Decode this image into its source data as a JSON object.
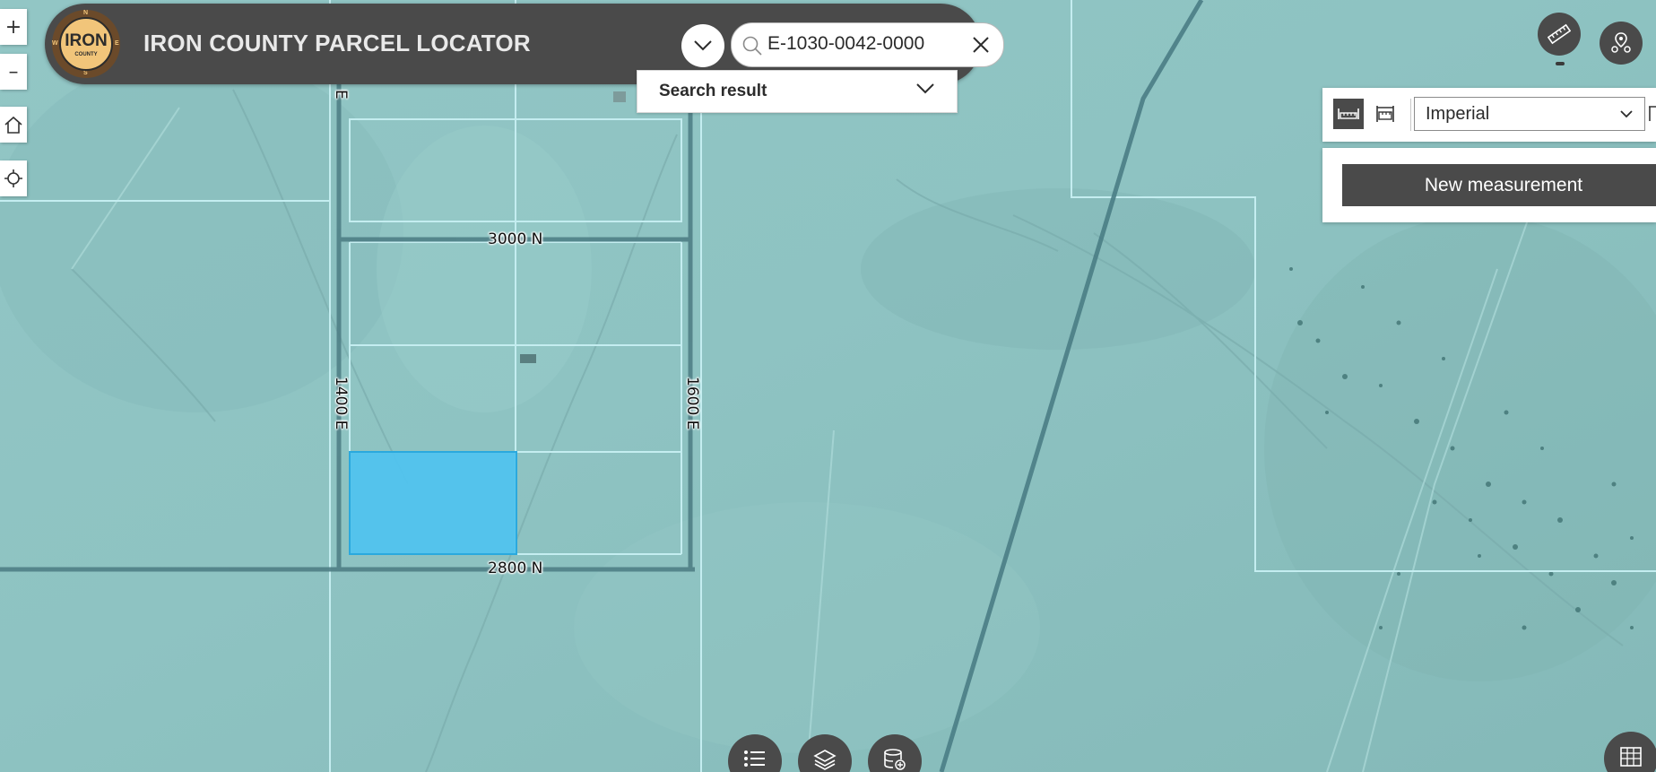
{
  "header": {
    "title": "IRON COUNTY PARCEL LOCATOR",
    "logo_text": "IRON",
    "logo_subtext": "COUNTY",
    "compass": {
      "n": "N",
      "e": "E",
      "s": "S",
      "w": "W"
    }
  },
  "search": {
    "value": "E-1030-0042-0000",
    "result_label": "Search result"
  },
  "map_controls": {
    "zoom_in": "+",
    "zoom_out": "–"
  },
  "measurement": {
    "unit_selected": "Imperial",
    "new_measurement_label": "New measurement"
  },
  "map": {
    "road_labels": [
      {
        "id": "3000n",
        "text": "3000 N",
        "orientation": "horizontal"
      },
      {
        "id": "2800n",
        "text": "2800 N",
        "orientation": "horizontal"
      },
      {
        "id": "1400e",
        "text": "1400 E",
        "orientation": "vertical"
      },
      {
        "id": "1600e",
        "text": "1600 E",
        "orientation": "vertical"
      },
      {
        "id": "topE",
        "text": "E",
        "orientation": "vertical"
      }
    ],
    "highlighted_parcel_color": "#4fc3f0",
    "parcel_line_color": "#bfe9ee"
  },
  "colors": {
    "header_bg": "#4a4a4a",
    "map_bg": "#8fc2c2",
    "button_dark": "#4a4a4a"
  }
}
